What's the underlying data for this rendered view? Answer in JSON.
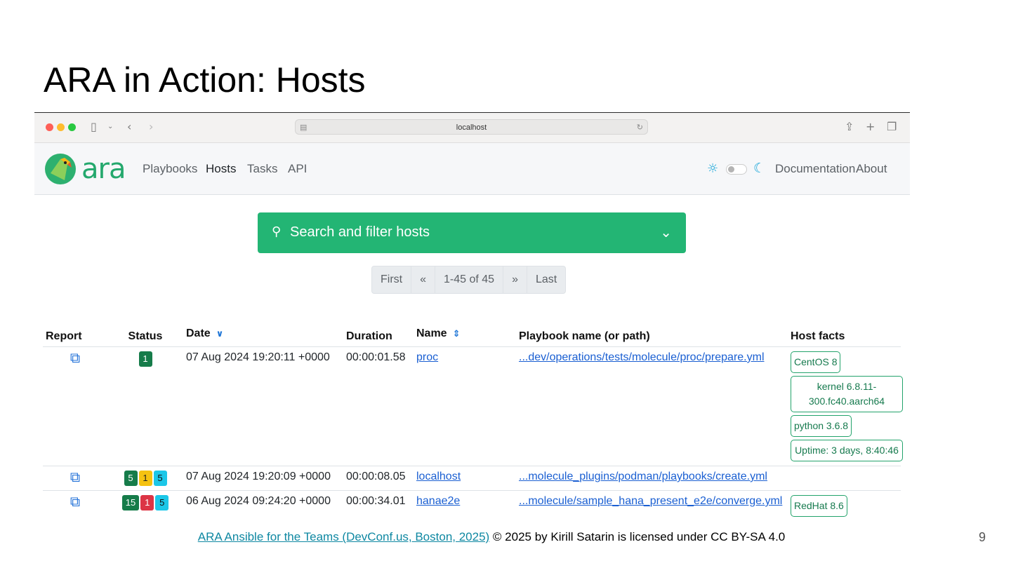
{
  "slide": {
    "title": "ARA in Action: Hosts",
    "footer_link": "ARA Ansible for the Teams (DevConf.us, Boston, 2025)",
    "footer_text": " © 2025 by Kirill Satarin is licensed under CC BY-SA 4.0",
    "page_number": "9"
  },
  "browser": {
    "url": "localhost"
  },
  "navbar": {
    "logo_text": "ara",
    "links": [
      "Playbooks",
      "Hosts",
      "Tasks",
      "API"
    ],
    "active": "Hosts",
    "right_links": [
      "Documentation",
      "About"
    ]
  },
  "search": {
    "label": "Search and filter hosts"
  },
  "pagination": {
    "first": "First",
    "prev": "«",
    "range": "1-45 of 45",
    "next": "»",
    "last": "Last"
  },
  "table": {
    "headers": {
      "report": "Report",
      "status": "Status",
      "date": "Date",
      "duration": "Duration",
      "name": "Name",
      "playbook": "Playbook name (or path)",
      "facts": "Host facts"
    },
    "rows": [
      {
        "status": [
          {
            "type": "ok",
            "value": "1"
          }
        ],
        "date": "07 Aug 2024 19:20:11 +0000",
        "duration": "00:00:01.58",
        "name": "proc",
        "playbook": "...dev/operations/tests/molecule/proc/prepare.yml",
        "facts": [
          "CentOS 8",
          "kernel 6.8.11-300.fc40.aarch64",
          "python 3.6.8",
          "Uptime: 3 days, 8:40:46"
        ]
      },
      {
        "status": [
          {
            "type": "ok",
            "value": "5"
          },
          {
            "type": "changed",
            "value": "1"
          },
          {
            "type": "skipped",
            "value": "5"
          }
        ],
        "date": "07 Aug 2024 19:20:09 +0000",
        "duration": "00:00:08.05",
        "name": "localhost",
        "playbook": "...molecule_plugins/podman/playbooks/create.yml",
        "facts": []
      },
      {
        "status": [
          {
            "type": "ok",
            "value": "15"
          },
          {
            "type": "failed",
            "value": "1"
          },
          {
            "type": "skipped",
            "value": "5"
          }
        ],
        "date": "06 Aug 2024 09:24:20 +0000",
        "duration": "00:00:34.01",
        "name": "hanae2e",
        "playbook": "...molecule/sample_hana_present_e2e/converge.yml",
        "facts": [
          "RedHat 8.6"
        ]
      }
    ]
  },
  "colors": {
    "brand_green": "#23b574",
    "link_blue": "#1a5fd2",
    "status_ok": "#167c4a",
    "status_changed": "#f5c211",
    "status_failed": "#dc3545",
    "status_skipped": "#1bc7e8"
  }
}
